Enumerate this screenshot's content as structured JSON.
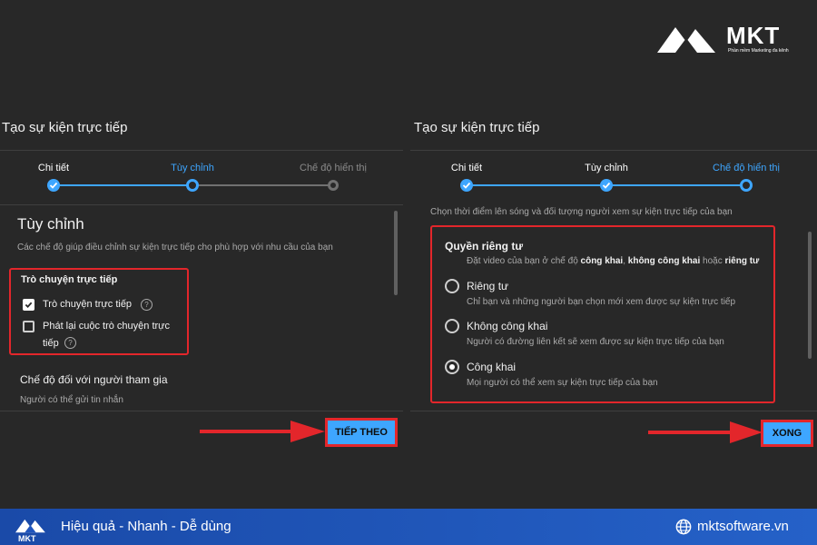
{
  "brand": {
    "name": "MKT",
    "tagline": "Phần mềm Marketing đa kênh"
  },
  "left": {
    "title": "Tạo sự kiện trực tiếp",
    "steps": [
      {
        "label": "Chi tiết",
        "state": "done"
      },
      {
        "label": "Tùy chỉnh",
        "state": "active"
      },
      {
        "label": "Chế độ hiển thị",
        "state": "todo"
      }
    ],
    "heading": "Tùy chỉnh",
    "description": "Các chế độ giúp điều chỉnh sự kiện trực tiếp cho phù hợp với nhu cầu của bạn",
    "chat_section": "Trò chuyện trực tiếp",
    "chat_option_1": "Trò chuyện trực tiếp",
    "chat_option_2_line1": "Phát lại cuộc trò chuyện trực",
    "chat_option_2_line2": "tiếp",
    "help_symbol": "?",
    "participant_heading": "Chế độ đối với người tham gia",
    "participant_desc": "Người có thể gửi tin nhắn",
    "next_button": "TIẾP THEO"
  },
  "right": {
    "title": "Tạo sự kiện trực tiếp",
    "steps": [
      {
        "label": "Chi tiết",
        "state": "done"
      },
      {
        "label": "Tùy chỉnh",
        "state": "done"
      },
      {
        "label": "Chế độ hiển thị",
        "state": "active"
      }
    ],
    "intro": "Chọn thời điểm lên sóng và đối tượng người xem sự kiện trực tiếp của bạn",
    "privacy_heading": "Quyền riêng tư",
    "privacy_desc_prefix": "Đặt video của bạn ở chế độ ",
    "privacy_desc_bold1": "công khai",
    "privacy_desc_sep": ", ",
    "privacy_desc_bold2": "không công khai",
    "privacy_desc_mid": " hoặc ",
    "privacy_desc_bold3": "riêng tư",
    "options": [
      {
        "label": "Riêng tư",
        "desc": "Chỉ bạn và những người bạn chọn mới xem được sự kiện trực tiếp",
        "selected": false
      },
      {
        "label": "Không công khai",
        "desc": "Người có đường liên kết sẽ xem được sự kiện trực tiếp của bạn",
        "selected": false
      },
      {
        "label": "Công khai",
        "desc": "Mọi người có thể xem sự kiện trực tiếp của bạn",
        "selected": true
      }
    ],
    "done_button": "XONG"
  },
  "footer": {
    "slogan": "Hiệu quả - Nhanh - Dễ dùng",
    "website": "mktsoftware.vn"
  },
  "colors": {
    "accent": "#3ea6ff",
    "highlight": "#e3262b",
    "footer": "#1f55bd"
  }
}
